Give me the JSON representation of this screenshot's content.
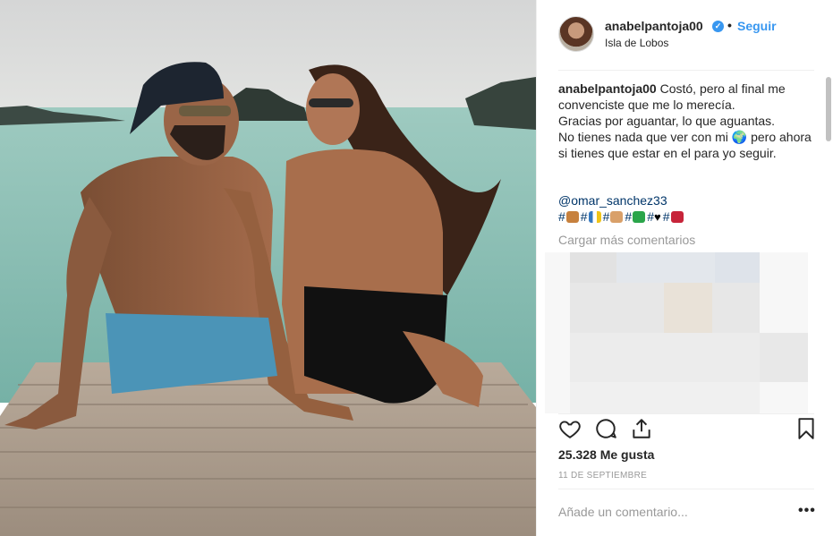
{
  "post": {
    "username": "anabelpantoja00",
    "follow_label": "Seguir",
    "dot": "•",
    "location": "Isla de Lobos",
    "caption_username": "anabelpantoja00",
    "caption_lines": [
      "Costó, pero al final me convenciste que me lo merecía.",
      "Gracias por aguantar, lo que aguantas.",
      "No tienes nada que ver con mi 🌍 pero ahora si tienes que estar en el para yo seguir."
    ],
    "mention": "@omar_sanchez33",
    "hashtags": [
      "#",
      "#",
      "#",
      "#",
      "#",
      "#"
    ],
    "load_more": "Cargar más comentarios",
    "likes": "25.328 Me gusta",
    "date": "11 DE SEPTIEMBRE",
    "comment_placeholder": "Añade un comentario...",
    "more_label": "•••"
  },
  "icons": [
    "heart-icon",
    "comment-icon",
    "share-icon",
    "bookmark-icon",
    "verified-icon"
  ],
  "colors": {
    "link": "#3897f0",
    "hashtag": "#003569",
    "muted": "#999999",
    "text": "#262626"
  }
}
